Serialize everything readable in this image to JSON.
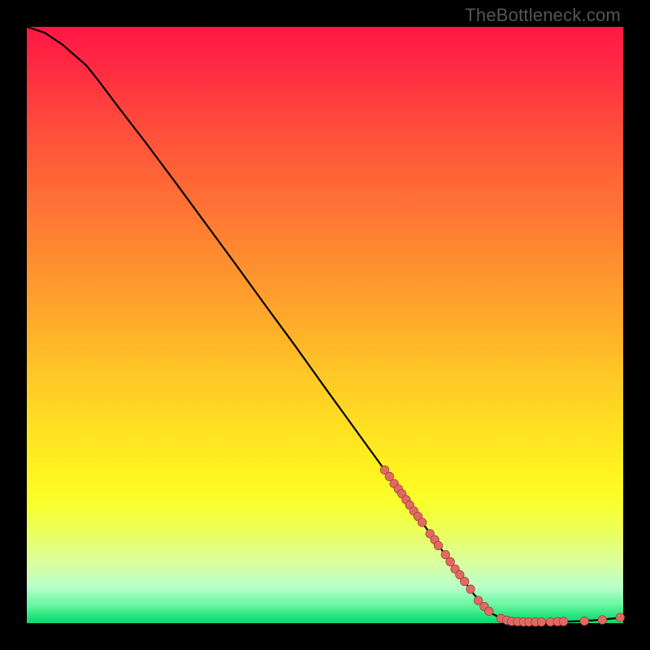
{
  "watermark": {
    "text": "TheBottleneck.com"
  },
  "colors": {
    "curve": "#000000",
    "marker_fill": "#e06a62",
    "marker_stroke": "#9c3b35"
  },
  "chart_data": {
    "type": "line",
    "title": "",
    "xlabel": "",
    "ylabel": "",
    "xlim": [
      0,
      100
    ],
    "ylim": [
      0,
      100
    ],
    "grid": false,
    "legend": false,
    "series": [
      {
        "name": "curve",
        "x": [
          0,
          3,
          6,
          10,
          12,
          15,
          20,
          25,
          30,
          35,
          40,
          45,
          50,
          55,
          60,
          65,
          70,
          72,
          75,
          78,
          80,
          82,
          84,
          86,
          88,
          90,
          93,
          96,
          99,
          100
        ],
        "y": [
          100,
          99,
          97,
          93.5,
          91,
          87,
          80.5,
          73.8,
          67.0,
          60.2,
          53.3,
          46.5,
          39.5,
          32.6,
          25.7,
          18.7,
          11.7,
          8.9,
          4.8,
          1.6,
          0.6,
          0.25,
          0.2,
          0.2,
          0.2,
          0.25,
          0.35,
          0.55,
          0.85,
          1.0
        ]
      }
    ],
    "markers": [
      {
        "x": 60.0,
        "y": 25.7,
        "r": 1.0
      },
      {
        "x": 60.8,
        "y": 24.6,
        "r": 1.0
      },
      {
        "x": 61.6,
        "y": 23.4,
        "r": 1.0
      },
      {
        "x": 62.3,
        "y": 22.5,
        "r": 1.0
      },
      {
        "x": 62.9,
        "y": 21.7,
        "r": 1.0
      },
      {
        "x": 63.6,
        "y": 20.7,
        "r": 1.0
      },
      {
        "x": 64.2,
        "y": 19.8,
        "r": 1.0
      },
      {
        "x": 64.9,
        "y": 18.8,
        "r": 1.0
      },
      {
        "x": 65.6,
        "y": 17.9,
        "r": 1.0
      },
      {
        "x": 66.3,
        "y": 16.9,
        "r": 1.0
      },
      {
        "x": 67.6,
        "y": 15.0,
        "r": 1.0
      },
      {
        "x": 68.4,
        "y": 14.0,
        "r": 1.0
      },
      {
        "x": 69.0,
        "y": 13.0,
        "r": 1.0
      },
      {
        "x": 70.2,
        "y": 11.5,
        "r": 1.0
      },
      {
        "x": 71.0,
        "y": 10.3,
        "r": 1.0
      },
      {
        "x": 71.8,
        "y": 9.1,
        "r": 1.0
      },
      {
        "x": 72.6,
        "y": 8.1,
        "r": 1.0
      },
      {
        "x": 73.4,
        "y": 7.0,
        "r": 1.0
      },
      {
        "x": 74.4,
        "y": 5.7,
        "r": 1.0
      },
      {
        "x": 75.7,
        "y": 3.8,
        "r": 1.0
      },
      {
        "x": 76.7,
        "y": 2.8,
        "r": 1.0
      },
      {
        "x": 77.5,
        "y": 2.0,
        "r": 1.0
      },
      {
        "x": 79.5,
        "y": 0.8,
        "r": 1.0
      },
      {
        "x": 80.5,
        "y": 0.5,
        "r": 1.0
      },
      {
        "x": 81.3,
        "y": 0.3,
        "r": 1.0
      },
      {
        "x": 82.3,
        "y": 0.25,
        "r": 1.0
      },
      {
        "x": 83.3,
        "y": 0.2,
        "r": 1.0
      },
      {
        "x": 84.2,
        "y": 0.2,
        "r": 1.0
      },
      {
        "x": 85.3,
        "y": 0.2,
        "r": 1.0
      },
      {
        "x": 86.3,
        "y": 0.2,
        "r": 1.0
      },
      {
        "x": 87.8,
        "y": 0.22,
        "r": 1.0
      },
      {
        "x": 89.0,
        "y": 0.25,
        "r": 1.0
      },
      {
        "x": 90.0,
        "y": 0.27,
        "r": 1.0
      },
      {
        "x": 93.5,
        "y": 0.35,
        "r": 1.0
      },
      {
        "x": 96.5,
        "y": 0.55,
        "r": 1.0
      },
      {
        "x": 99.5,
        "y": 0.95,
        "r": 1.0
      }
    ]
  }
}
